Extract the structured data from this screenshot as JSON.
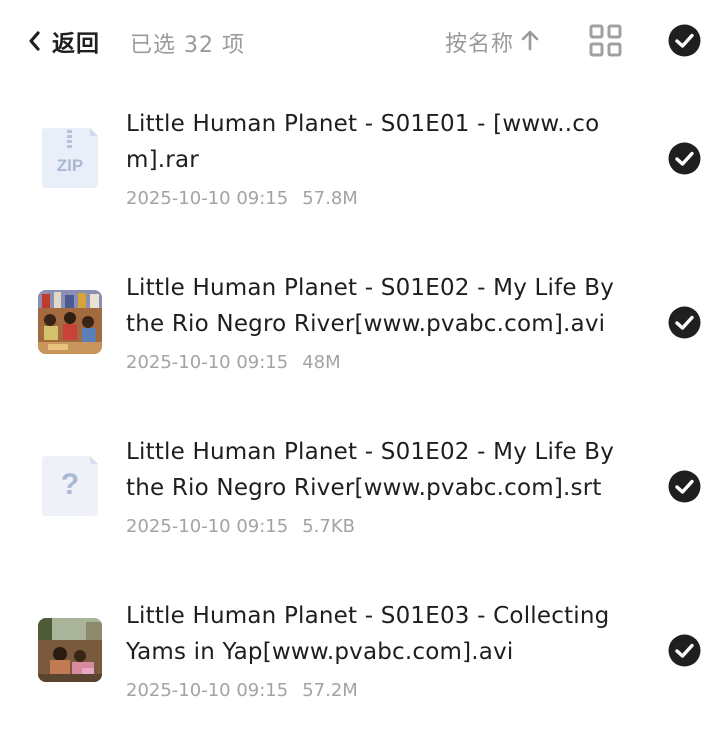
{
  "header": {
    "back_label": "返回",
    "selected_text": "已选 32 项",
    "sort_label": "按名称",
    "sort_direction_icon": "arrow-up-icon",
    "view_toggle_icon": "grid-view-icon",
    "select_all_icon": "check-circle-icon"
  },
  "files": [
    {
      "name": "Little Human Planet - S01E01 - [www..com].rar",
      "date": "2025-10-10 09:15",
      "size": "57.8M",
      "thumb": "zip-file-icon",
      "thumb_label": "ZIP",
      "selected": true
    },
    {
      "name": "Little Human Planet - S01E02 - My Life By the Rio Negro River[www.pvabc.com].avi",
      "date": "2025-10-10 09:15",
      "size": "48M",
      "thumb": "video-thumbnail",
      "selected": true
    },
    {
      "name": "Little Human Planet - S01E02 - My Life By the Rio Negro River[www.pvabc.com].srt",
      "date": "2025-10-10 09:15",
      "size": "5.7KB",
      "thumb": "unknown-file-icon",
      "thumb_label": "?",
      "selected": true
    },
    {
      "name": "Little Human Planet - S01E03 - Collecting Yams in Yap[www.pvabc.com].avi",
      "date": "2025-10-10 09:15",
      "size": "57.2M",
      "thumb": "video-thumbnail",
      "selected": true
    }
  ],
  "colors": {
    "check_fill": "#1f1f1f",
    "muted_text": "#9a9a9a",
    "primary_text": "#1e1e1e"
  }
}
